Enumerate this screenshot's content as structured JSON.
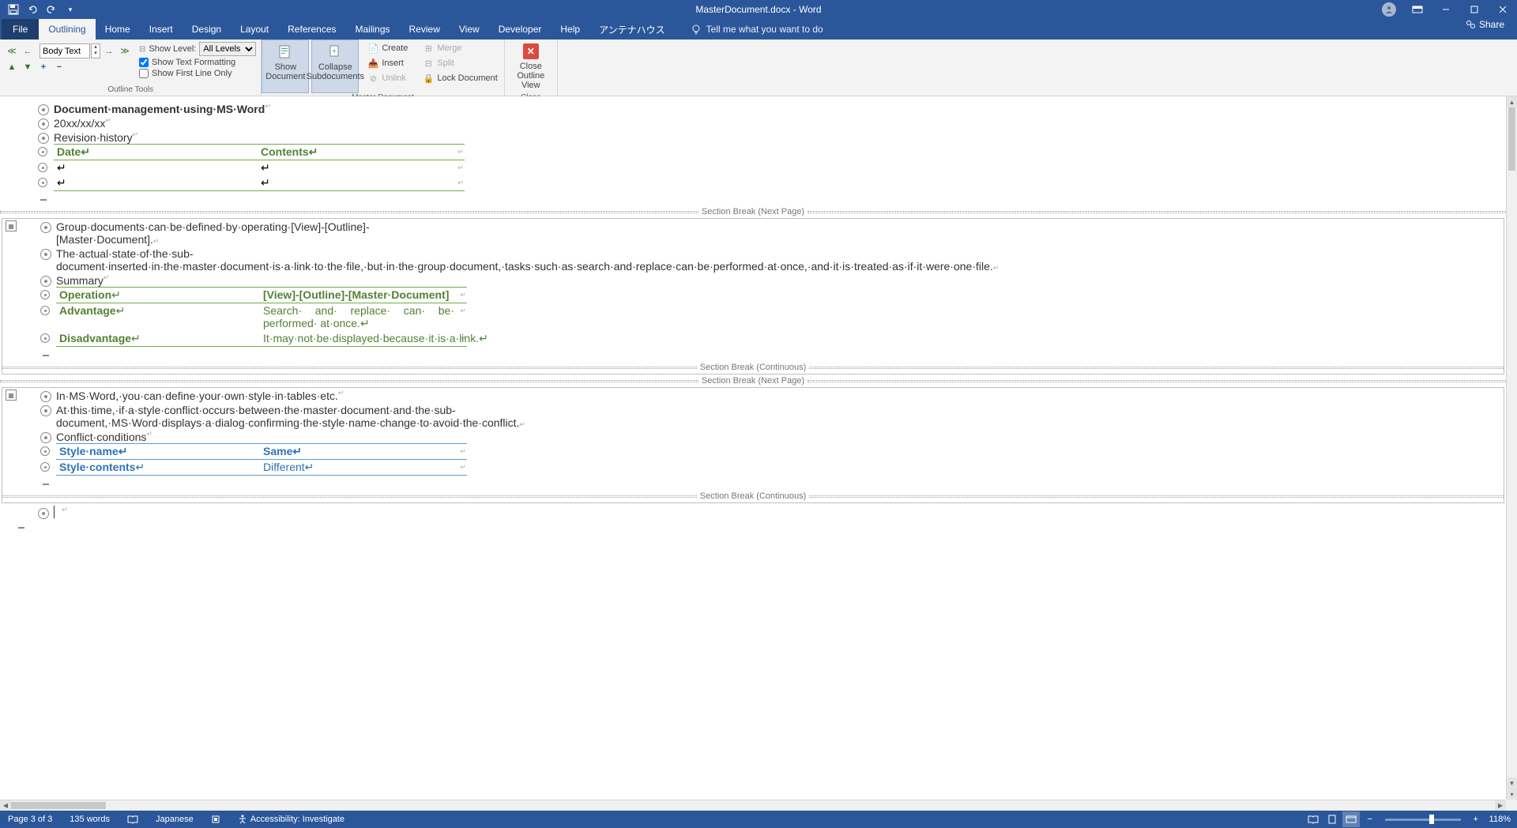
{
  "title": "MasterDocument.docx - Word",
  "tabs": {
    "file": "File",
    "outlining": "Outlining",
    "home": "Home",
    "insert": "Insert",
    "design": "Design",
    "layout": "Layout",
    "references": "References",
    "mailings": "Mailings",
    "review": "Review",
    "view": "View",
    "developer": "Developer",
    "help": "Help",
    "antenna": "アンテナハウス",
    "tell": "Tell me what you want to do",
    "share": "Share"
  },
  "ribbon": {
    "outline_level": "Body Text",
    "show_level_label": "Show Level:",
    "show_level_value": "All Levels",
    "show_text_fmt": "Show Text Formatting",
    "show_first_line": "Show First Line Only",
    "outline_tools": "Outline Tools",
    "show_doc": "Show Document",
    "collapse_sub": "Collapse Subdocuments",
    "create": "Create",
    "insert": "Insert",
    "unlink": "Unlink",
    "merge": "Merge",
    "split": "Split",
    "lock": "Lock Document",
    "master_doc": "Master Document",
    "close_outline": "Close Outline View",
    "close": "Close"
  },
  "doc": {
    "l1": "Document·management·using·MS·Word",
    "l2": "20xx/xx/xx",
    "l3": "Revision·history",
    "t1h1": "Date",
    "t1h2": "Contents",
    "sb_next": "Section Break (Next Page)",
    "sb_cont": "Section Break (Continuous)",
    "p1": "Group·documents·can·be·defined·by·operating·[View]-[Outline]-[Master·Document].",
    "p2": "The·actual·state·of·the·sub-document·inserted·in·the·master·document·is·a·link·to·the·file,·but·in·the·group·document,·tasks·such·as·search·and·replace·can·be·performed·at·once,·and·it·is·treated·as·if·it·were·one·file.",
    "p3": "Summary",
    "t2r1c1": "Operation",
    "t2r1c2": "[View]-[Outline]-[Master·Document]",
    "t2r2c1": "Advantage",
    "t2r2c2": "Search· and· replace· can· be· performed· at·once.",
    "t2r3c1": "Disadvantage",
    "t2r3c2": "It·may·not·be·displayed·because·it·is·a·link.",
    "p4": "In·MS·Word,·you·can·define·your·own·style·in·tables·etc.",
    "p5": "At·this·time,·if·a·style·conflict·occurs·between·the·master·document·and·the·sub-document,·MS·Word·displays·a·dialog·confirming·the·style·name·change·to·avoid·the·conflict.",
    "p6": "Conflict·conditions",
    "t3r1c1": "Style·name",
    "t3r1c2": "Same",
    "t3r2c1": "Style·contents",
    "t3r2c2": "Different"
  },
  "status": {
    "page": "Page 3 of 3",
    "words": "135 words",
    "lang": "Japanese",
    "access": "Accessibility: Investigate",
    "zoom": "118%"
  }
}
